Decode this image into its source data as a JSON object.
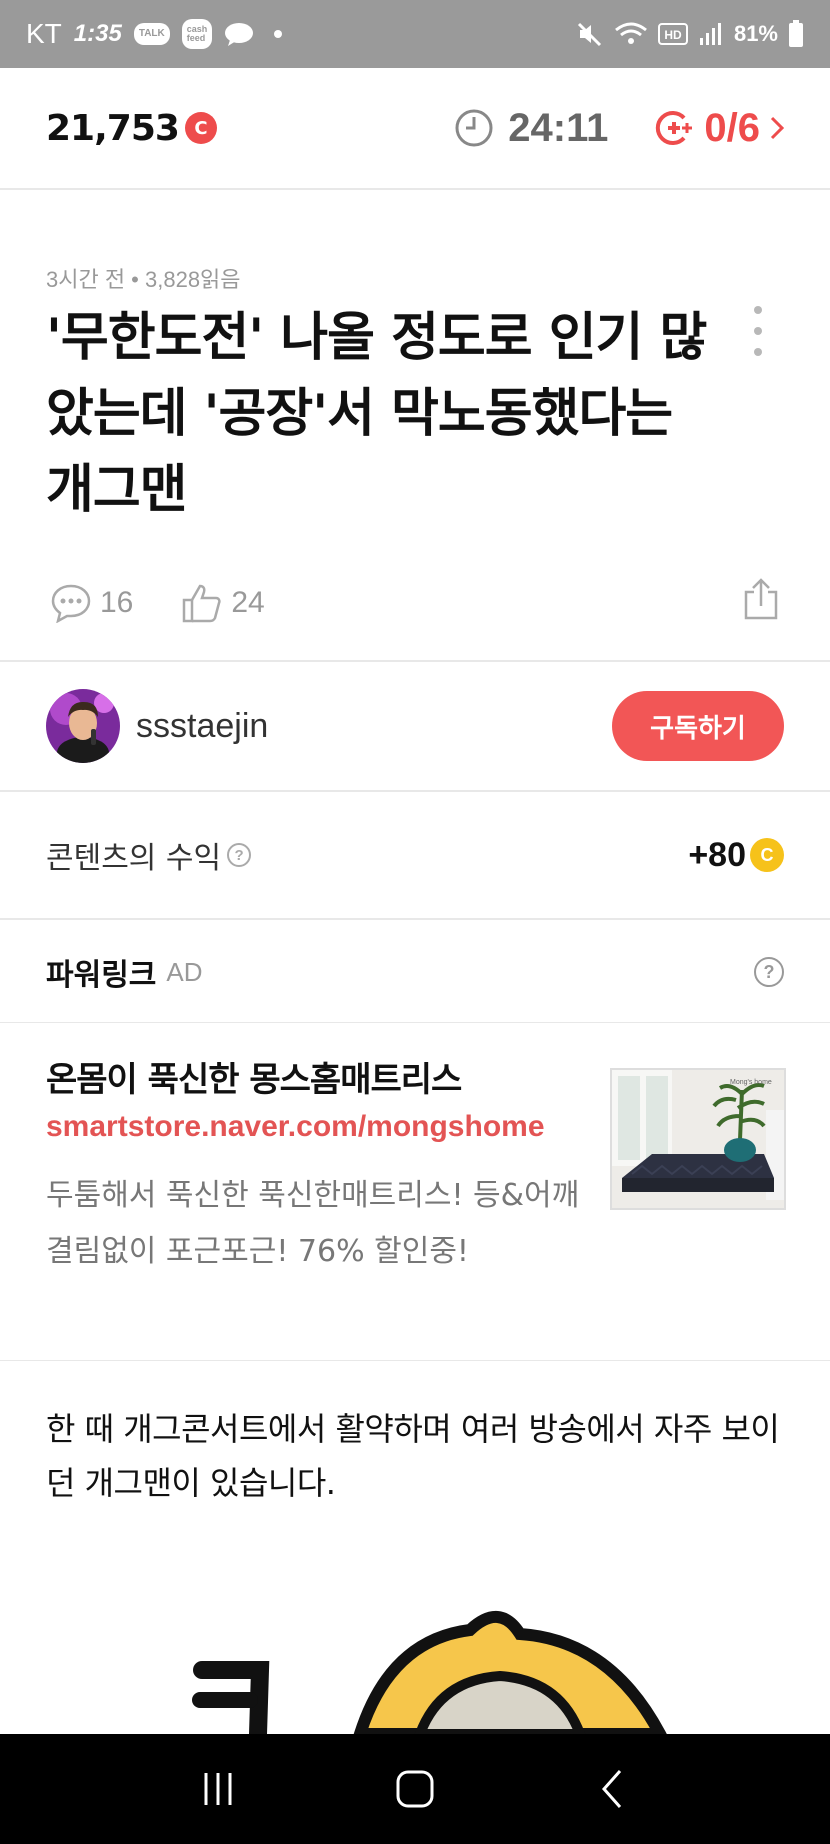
{
  "status_bar": {
    "carrier": "KT",
    "time": "1:35",
    "notif_talk": "TALK",
    "notif_cash": "cash\nfeed",
    "battery": "81%"
  },
  "points_bar": {
    "amount": "21,753",
    "coin_symbol": "C",
    "timer": "24:11",
    "mission": "0/6"
  },
  "article": {
    "meta": "3시간 전 • 3,828읽음",
    "title": "'무한도전' 나올 정도로 인기 많았는데 '공장'서 막노동했다는 개그맨",
    "comments": "16",
    "likes": "24"
  },
  "author": {
    "name": "ssstaejin",
    "subscribe_label": "구독하기"
  },
  "revenue": {
    "label": "콘텐츠의 수익",
    "help": "?",
    "amount": "+80",
    "coin_symbol": "C"
  },
  "powerlink": {
    "title": "파워링크",
    "tag": "AD",
    "help": "?",
    "headline": "온몸이 푹신한 몽스홈매트리스",
    "url": "smartstore.naver.com/mongshome",
    "description": "두툼해서 푹신한 푹신한매트리스! 등&어깨 결림없이 포근포근! 76% 할인중!",
    "thumb_logo": "Mong's home"
  },
  "body": {
    "paragraph": "한 때 개그콘서트에서 활약하며 여러 방송에서 자주 보이던 개그맨이 있습니다."
  },
  "colors": {
    "accent_red": "#f25656",
    "coin_yellow": "#f6c21a",
    "status_bar_bg": "#9a9a9a"
  },
  "icons": {
    "timer": "clock-icon",
    "mission": "coin-plus-icon",
    "comment": "speech-bubble-icon",
    "like": "thumbs-up-icon",
    "share": "share-icon",
    "more": "kebab-menu-icon",
    "nav_recent": "recent-apps-icon",
    "nav_home": "home-icon",
    "nav_back": "back-icon"
  }
}
